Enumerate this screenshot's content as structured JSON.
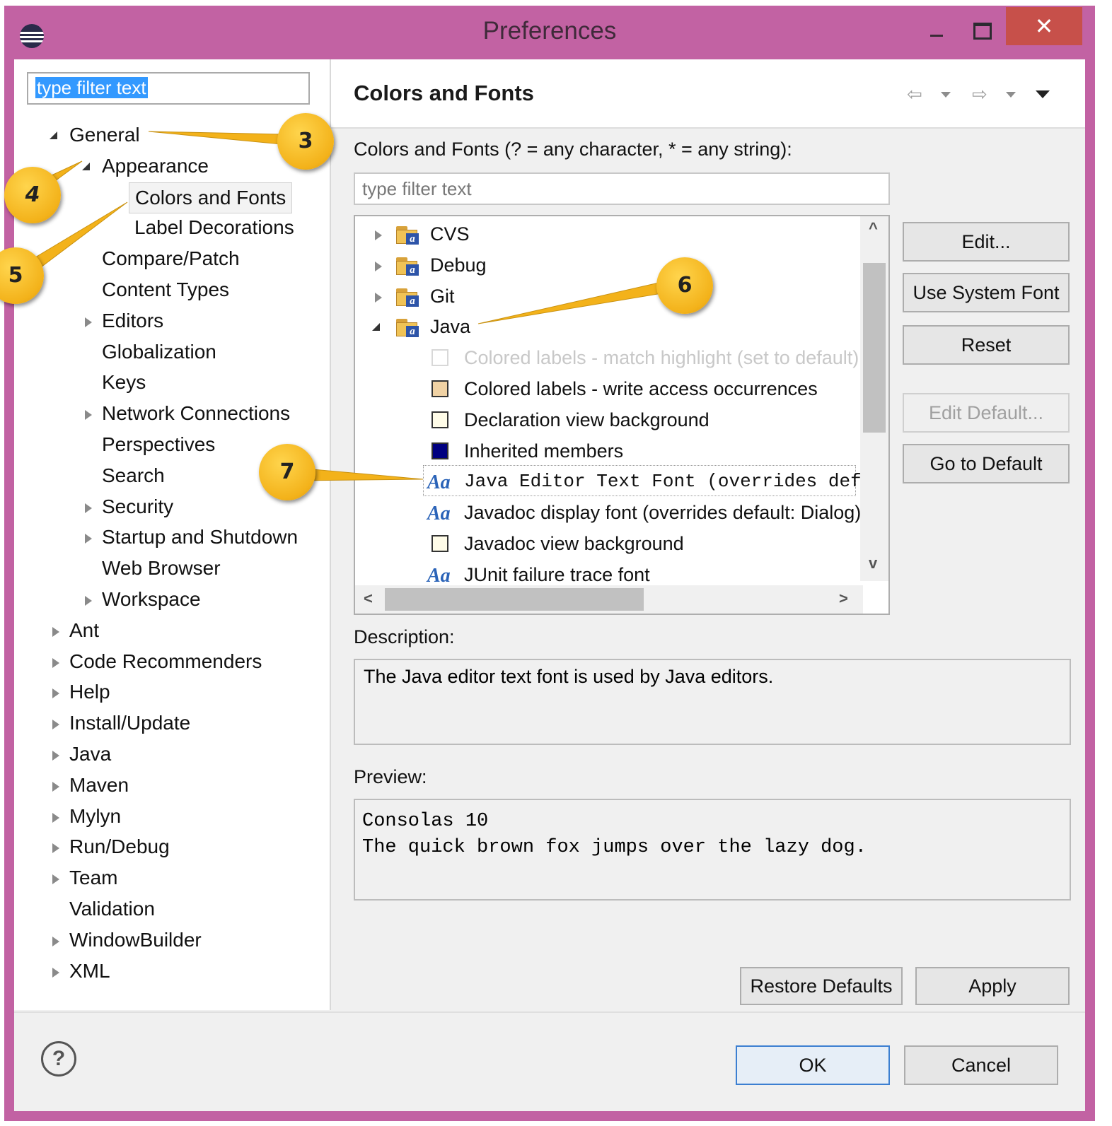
{
  "window": {
    "title": "Preferences",
    "close_glyph": "✕",
    "colors": {
      "frame": "#c262a3",
      "close": "#c7504a",
      "callout": "#f3b21a"
    }
  },
  "left_tree": {
    "filter_value": "type filter text",
    "items": [
      {
        "label": "General",
        "state": "open",
        "level": 0
      },
      {
        "label": "Appearance",
        "state": "open",
        "level": 1
      },
      {
        "label": "Colors and Fonts",
        "state": "leaf",
        "level": 2,
        "selected": true
      },
      {
        "label": "Label Decorations",
        "state": "leaf",
        "level": 2
      },
      {
        "label": "Compare/Patch",
        "state": "leaf",
        "level": 1
      },
      {
        "label": "Content Types",
        "state": "leaf",
        "level": 1
      },
      {
        "label": "Editors",
        "state": "closed",
        "level": 1
      },
      {
        "label": "Globalization",
        "state": "leaf",
        "level": 1
      },
      {
        "label": "Keys",
        "state": "leaf",
        "level": 1
      },
      {
        "label": "Network Connections",
        "state": "closed",
        "level": 1
      },
      {
        "label": "Perspectives",
        "state": "leaf",
        "level": 1
      },
      {
        "label": "Search",
        "state": "leaf",
        "level": 1
      },
      {
        "label": "Security",
        "state": "closed",
        "level": 1
      },
      {
        "label": "Startup and Shutdown",
        "state": "closed",
        "level": 1
      },
      {
        "label": "Web Browser",
        "state": "leaf",
        "level": 1
      },
      {
        "label": "Workspace",
        "state": "closed",
        "level": 1
      },
      {
        "label": "Ant",
        "state": "closed",
        "level": 0
      },
      {
        "label": "Code Recommenders",
        "state": "closed",
        "level": 0
      },
      {
        "label": "Help",
        "state": "closed",
        "level": 0
      },
      {
        "label": "Install/Update",
        "state": "closed",
        "level": 0
      },
      {
        "label": "Java",
        "state": "closed",
        "level": 0
      },
      {
        "label": "Maven",
        "state": "closed",
        "level": 0
      },
      {
        "label": "Mylyn",
        "state": "closed",
        "level": 0
      },
      {
        "label": "Run/Debug",
        "state": "closed",
        "level": 0
      },
      {
        "label": "Team",
        "state": "closed",
        "level": 0
      },
      {
        "label": "Validation",
        "state": "leaf",
        "level": 0
      },
      {
        "label": "WindowBuilder",
        "state": "closed",
        "level": 0
      },
      {
        "label": "XML",
        "state": "closed",
        "level": 0
      }
    ]
  },
  "page": {
    "title": "Colors and Fonts",
    "filter_label": "Colors and Fonts (? = any character, * = any string):",
    "filter_placeholder": "type filter text",
    "tree": [
      {
        "label": "CVS",
        "kind": "folder",
        "state": "closed"
      },
      {
        "label": "Debug",
        "kind": "folder",
        "state": "closed"
      },
      {
        "label": "Git",
        "kind": "folder",
        "state": "closed"
      },
      {
        "label": "Java",
        "kind": "folder",
        "state": "open"
      },
      {
        "label": "Colored labels - match highlight (set to default)",
        "kind": "color",
        "swatch": "#ffffff",
        "disabled": true
      },
      {
        "label": "Colored labels - write access occurrences",
        "kind": "color",
        "swatch": "#f0d2a4"
      },
      {
        "label": "Declaration view background",
        "kind": "color",
        "swatch": "#fffce8"
      },
      {
        "label": "Inherited members",
        "kind": "color",
        "swatch": "#000080"
      },
      {
        "label": "Java Editor Text Font (overrides default)",
        "kind": "font",
        "selected": true
      },
      {
        "label": "Javadoc display font (overrides default: Dialog)",
        "kind": "font"
      },
      {
        "label": "Javadoc view background",
        "kind": "color",
        "swatch": "#fffce8"
      },
      {
        "label": "JUnit failure trace font",
        "kind": "font"
      }
    ],
    "font_icon_text": "Aa",
    "buttons": {
      "edit": "Edit...",
      "use_system_font": "Use System Font",
      "reset": "Reset",
      "edit_default": "Edit Default...",
      "go_to_default": "Go to Default"
    },
    "description_label": "Description:",
    "description": "The Java editor text font is used by Java editors.",
    "preview_label": "Preview:",
    "preview_line1": "Consolas 10",
    "preview_line2": "The quick brown fox jumps over the lazy dog.",
    "restore_defaults": "Restore Defaults",
    "apply": "Apply"
  },
  "footer": {
    "help_glyph": "?",
    "ok": "OK",
    "cancel": "Cancel"
  },
  "nav": {
    "back_glyph": "⇦",
    "forward_glyph": "⇨"
  },
  "scroll_glyphs": {
    "up": "^",
    "down": "v",
    "left": "<",
    "right": ">"
  },
  "callouts": [
    "3",
    "4",
    "5",
    "6",
    "7"
  ]
}
